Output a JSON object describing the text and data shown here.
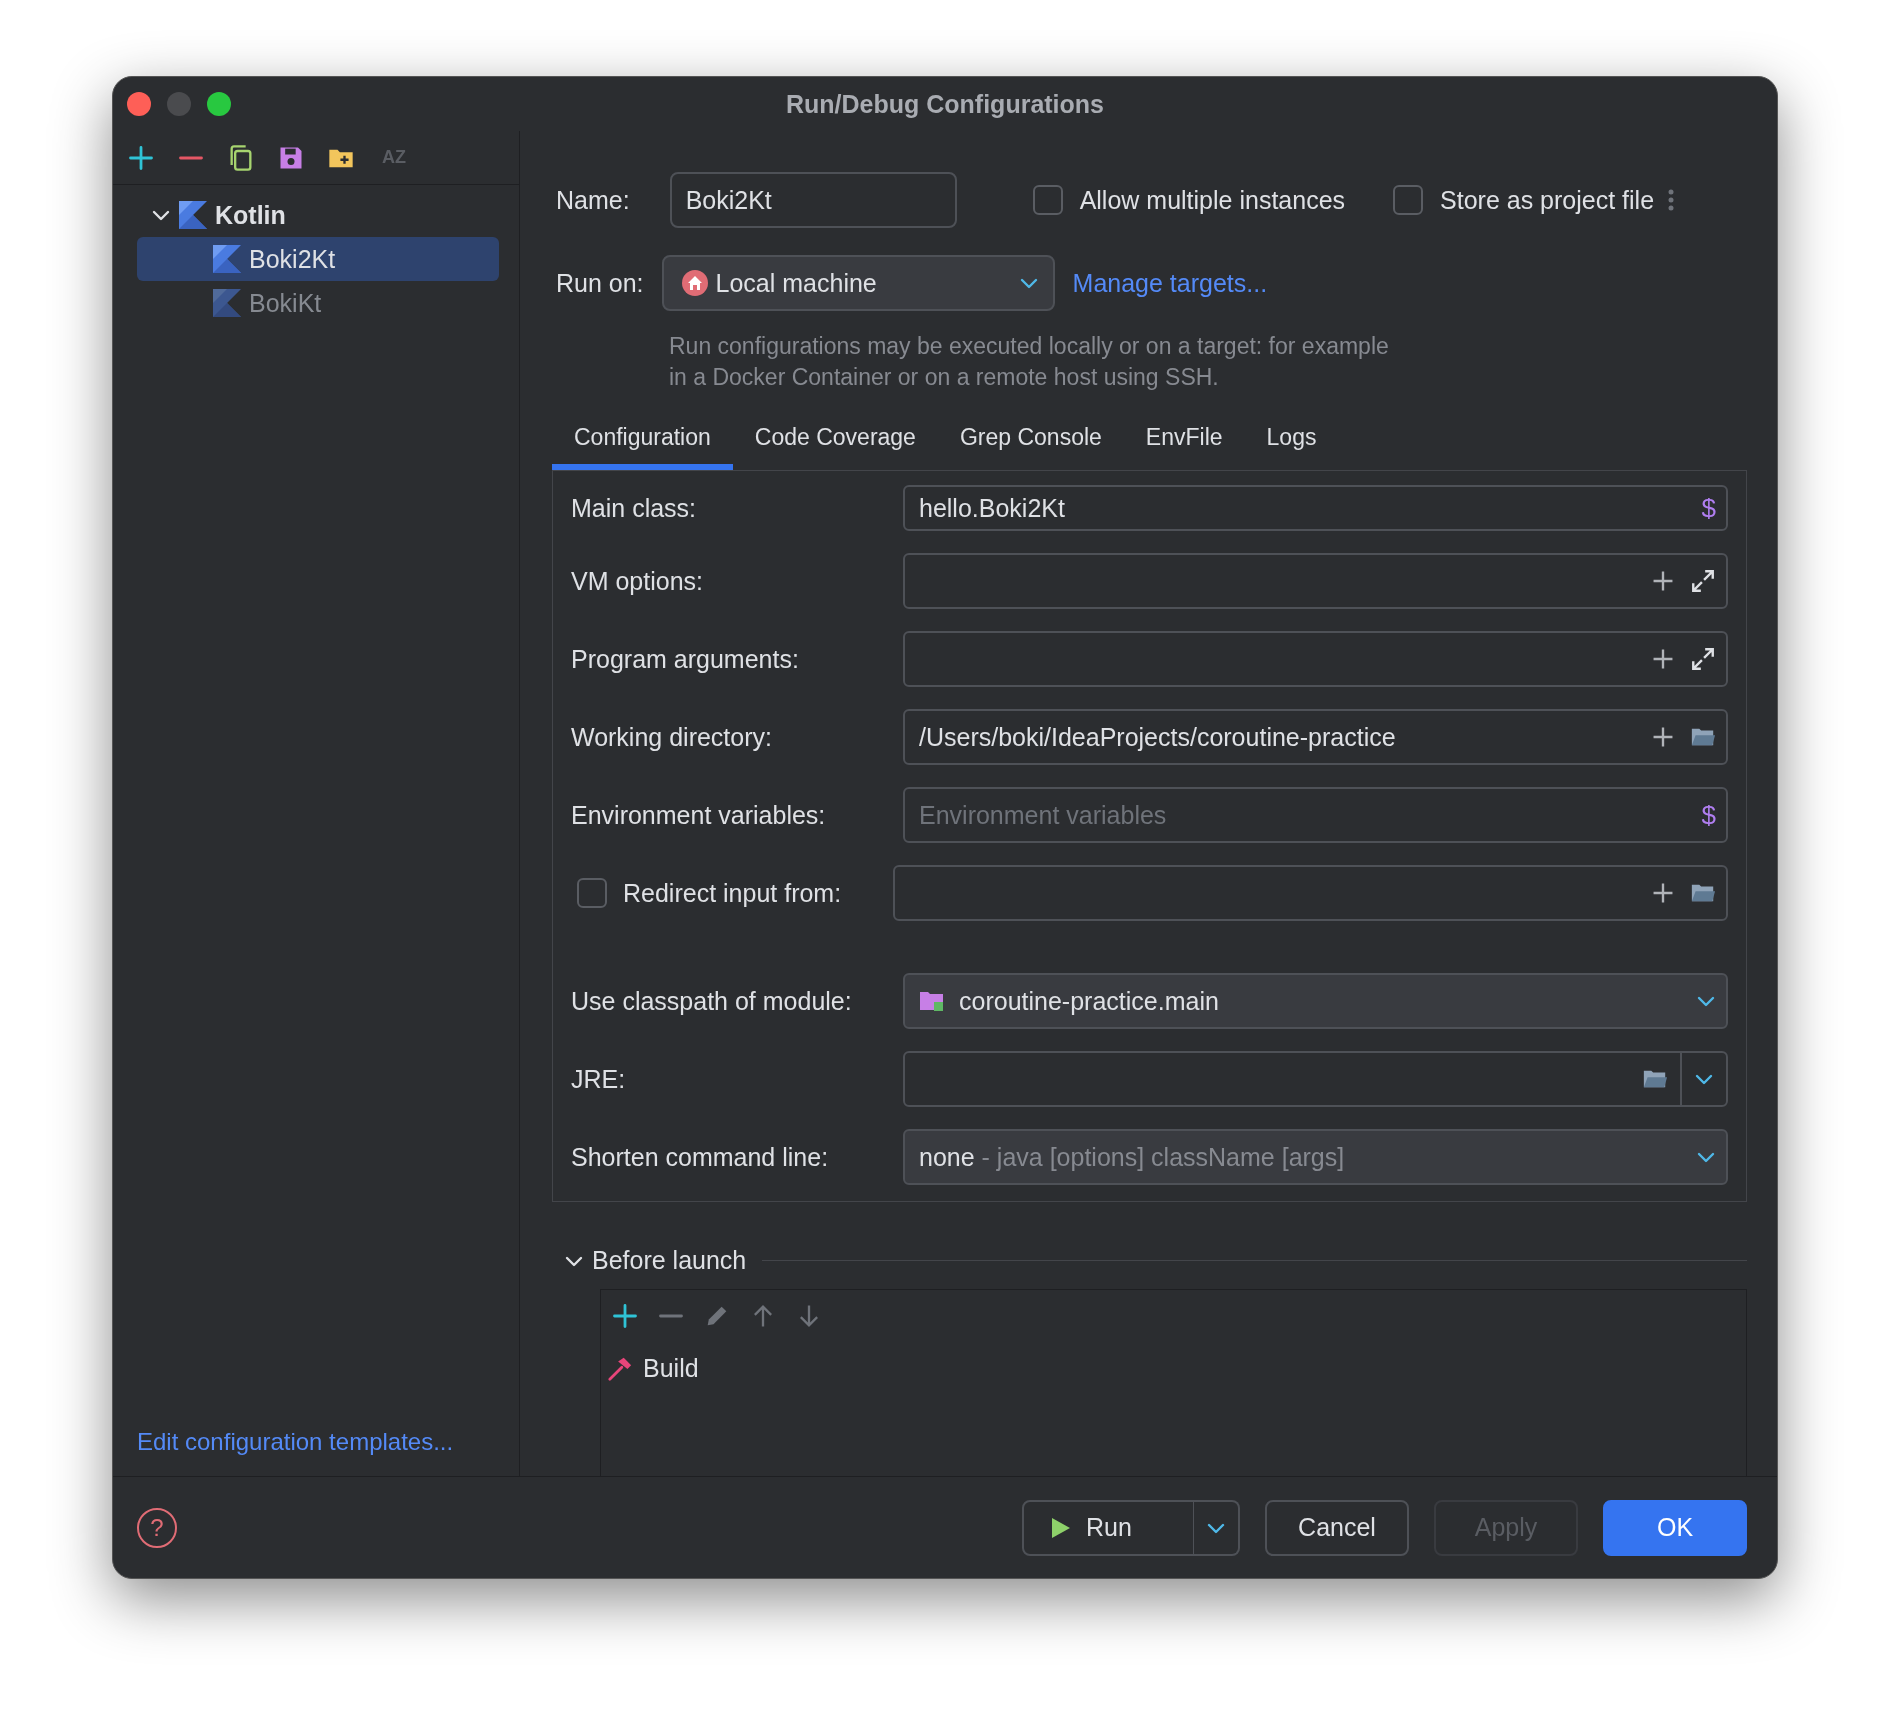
{
  "window": {
    "title": "Run/Debug Configurations",
    "controls": [
      {
        "kind": "close",
        "disabled": false
      },
      {
        "kind": "minimize",
        "disabled": true
      },
      {
        "kind": "zoom",
        "disabled": false
      }
    ]
  },
  "sidebar": {
    "toolbar": [
      {
        "kind": "add",
        "disabled": false
      },
      {
        "kind": "remove",
        "disabled": false
      },
      {
        "kind": "copy",
        "disabled": false
      },
      {
        "kind": "save",
        "disabled": false
      },
      {
        "kind": "new_folder",
        "disabled": false
      },
      {
        "kind": "sort",
        "label": "AZ",
        "disabled": true
      }
    ],
    "tree": [
      {
        "label": "Kotlin",
        "expanded": true,
        "selected": false,
        "disabled": false,
        "children": [
          {
            "label": "Boki2Kt",
            "selected": true,
            "disabled": false
          },
          {
            "label": "BokiKt",
            "selected": false,
            "disabled": true
          }
        ]
      }
    ],
    "link": "Edit configuration templates..."
  },
  "header": {
    "name": {
      "label": "Name:",
      "value": "Boki2Kt"
    },
    "options": [
      {
        "label": "Allow multiple instances",
        "checked": false
      },
      {
        "label": "Store as project file",
        "checked": false
      }
    ],
    "run_on": {
      "label": "Run on:",
      "value": "Local machine",
      "link": "Manage targets..."
    },
    "hint": "Run configurations may be executed locally or on a target: for example in a Docker Container or on a remote host using SSH."
  },
  "tabs": [
    {
      "label": "Configuration",
      "selected": true
    },
    {
      "label": "Code Coverage",
      "selected": false
    },
    {
      "label": "Grep Console",
      "selected": false
    },
    {
      "label": "EnvFile",
      "selected": false
    },
    {
      "label": "Logs",
      "selected": false
    }
  ],
  "fields": [
    {
      "kind": "macro",
      "label": "Main class:",
      "value": "hello.Boki2Kt",
      "icon": "$"
    },
    {
      "kind": "expandable",
      "label": "VM options:"
    },
    {
      "kind": "expandable",
      "label": "Program arguments:"
    },
    {
      "kind": "directory",
      "label": "Working directory:",
      "value": "/Users/boki/IdeaProjects/coroutine-practice"
    },
    {
      "kind": "macro",
      "label": "Environment variables:",
      "placeholder": "Environment variables",
      "icon": "$"
    },
    {
      "kind": "redirect",
      "label": "Redirect input from:",
      "checked": false
    },
    {
      "kind": "module",
      "label": "Use classpath of module:",
      "value": "coroutine-practice.main"
    },
    {
      "kind": "jre",
      "label": "JRE:"
    },
    {
      "kind": "shorten",
      "label": "Shorten command line:",
      "value": "none",
      "description": "- java [options] className [args]"
    }
  ],
  "before_launch": {
    "title": "Before launch",
    "expanded": true,
    "toolbar": [
      {
        "kind": "add",
        "disabled": false
      },
      {
        "kind": "remove",
        "disabled": true
      },
      {
        "kind": "edit",
        "disabled": true
      },
      {
        "kind": "up",
        "disabled": true
      },
      {
        "kind": "down",
        "disabled": true
      }
    ],
    "tasks": [
      {
        "label": "Build"
      }
    ]
  },
  "footer": {
    "help": "?",
    "buttons": [
      {
        "kind": "run",
        "label": "Run",
        "disabled": false
      },
      {
        "kind": "plain",
        "label": "Cancel",
        "disabled": false
      },
      {
        "kind": "plain",
        "label": "Apply",
        "disabled": true
      },
      {
        "kind": "default",
        "label": "OK",
        "disabled": false
      }
    ]
  }
}
